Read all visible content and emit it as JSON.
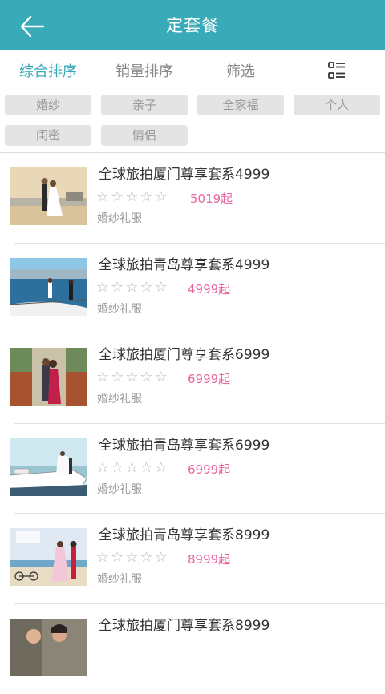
{
  "header": {
    "title": "定套餐"
  },
  "sort_bar": {
    "tabs": [
      {
        "label": "综合排序",
        "active": true
      },
      {
        "label": "销量排序",
        "active": false
      },
      {
        "label": "筛选",
        "active": false
      }
    ]
  },
  "tags": [
    "婚纱",
    "亲子",
    "全家福",
    "个人",
    "闺密",
    "情侣"
  ],
  "items": [
    {
      "title": "全球旅拍厦门尊享套系4999",
      "price": "5019起",
      "category": "婚纱礼服",
      "rating": 0
    },
    {
      "title": "全球旅拍青岛尊享套系4999",
      "price": "4999起",
      "category": "婚纱礼服",
      "rating": 0
    },
    {
      "title": "全球旅拍厦门尊享套系6999",
      "price": "6999起",
      "category": "婚纱礼服",
      "rating": 0
    },
    {
      "title": "全球旅拍青岛尊享套系6999",
      "price": "6999起",
      "category": "婚纱礼服",
      "rating": 0
    },
    {
      "title": "全球旅拍青岛尊享套系8999",
      "price": "8999起",
      "category": "婚纱礼服",
      "rating": 0
    },
    {
      "title": "全球旅拍厦门尊享套系8999",
      "price": "",
      "category": "",
      "rating": 0
    }
  ],
  "colors": {
    "accent": "#38aab8",
    "price": "#e966a0"
  }
}
